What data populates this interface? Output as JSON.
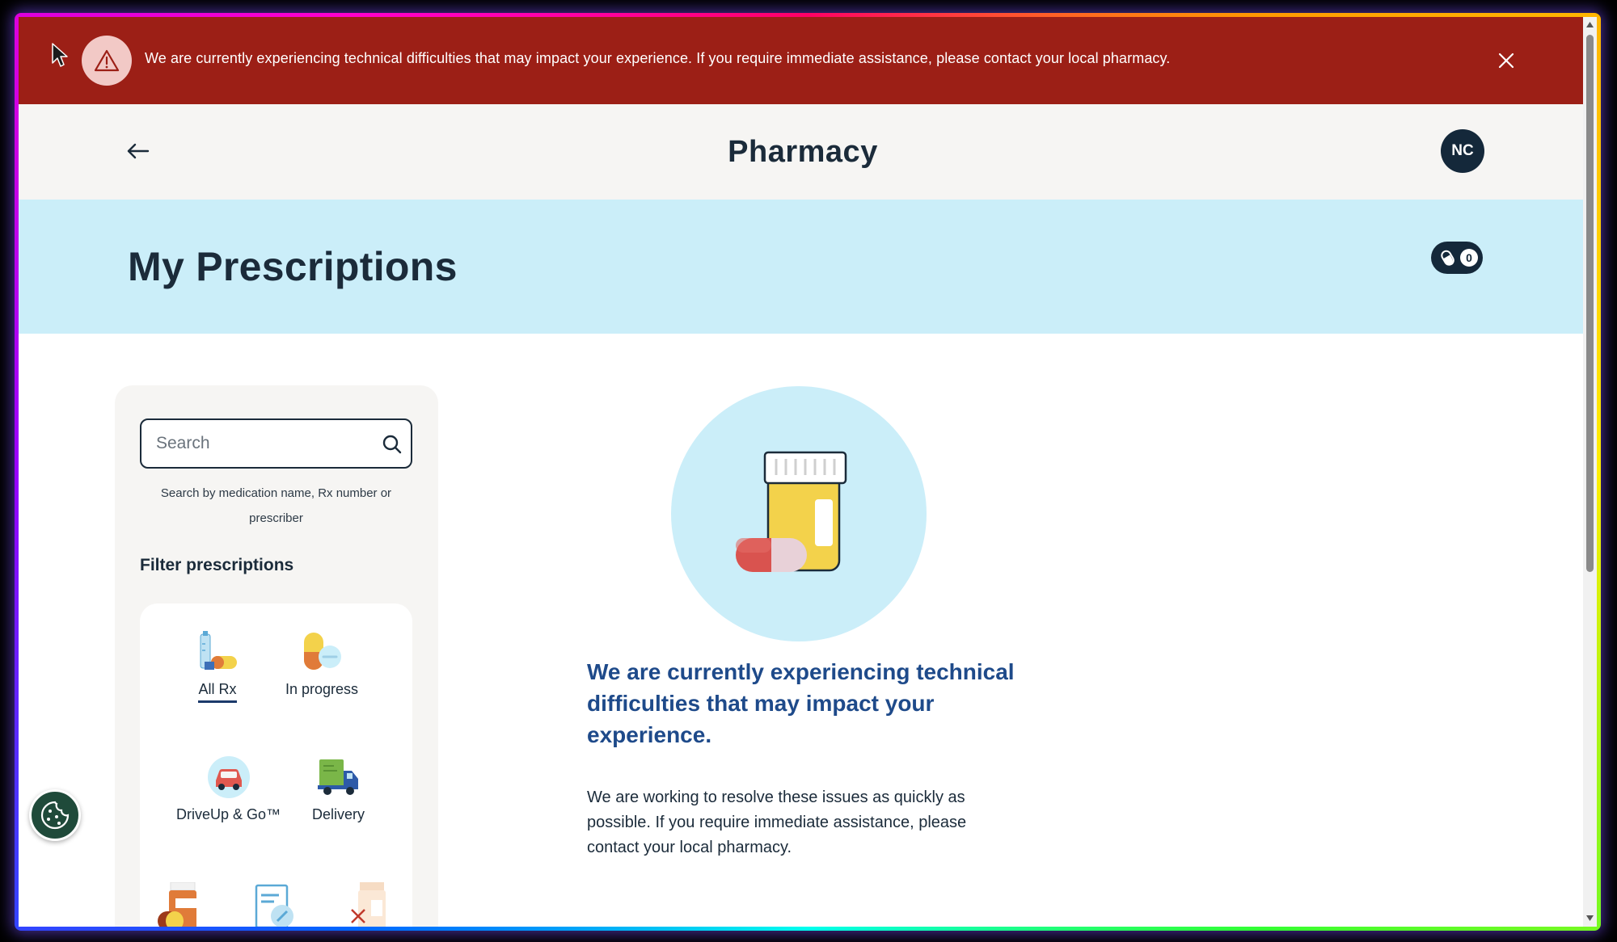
{
  "alert": {
    "message": "We are currently experiencing technical difficulties that may impact your experience. If you require immediate assistance, please contact your local pharmacy.",
    "icon": "warning-triangle-icon",
    "close_icon": "close-icon",
    "background": "#9c1f16"
  },
  "header": {
    "title": "Pharmacy",
    "back_icon": "back-arrow-icon",
    "avatar_initials": "NC"
  },
  "page": {
    "title": "My Prescriptions",
    "cart_count": "0",
    "band_color": "#cbeef9"
  },
  "sidebar": {
    "search": {
      "placeholder": "Search",
      "value": "",
      "help_text": "Search by medication name, Rx number or prescriber"
    },
    "filter_title": "Filter prescriptions",
    "filters": [
      {
        "label": "All Rx",
        "icon": "all-rx-icon",
        "active": true
      },
      {
        "label": "In progress",
        "icon": "in-progress-icon",
        "active": false
      },
      {
        "label": "DriveUp & Go™",
        "icon": "car-icon",
        "active": false
      },
      {
        "label": "Delivery",
        "icon": "delivery-truck-icon",
        "active": false
      }
    ]
  },
  "main": {
    "heading": "We are currently experiencing technical difficulties that may impact your experience.",
    "body": "We are working to resolve these issues as quickly as possible. If you require immediate assistance, please contact your local pharmacy.",
    "illustration": "pill-bottle-icon"
  },
  "colors": {
    "accent": "#1e4a8a",
    "navy": "#14283a"
  }
}
